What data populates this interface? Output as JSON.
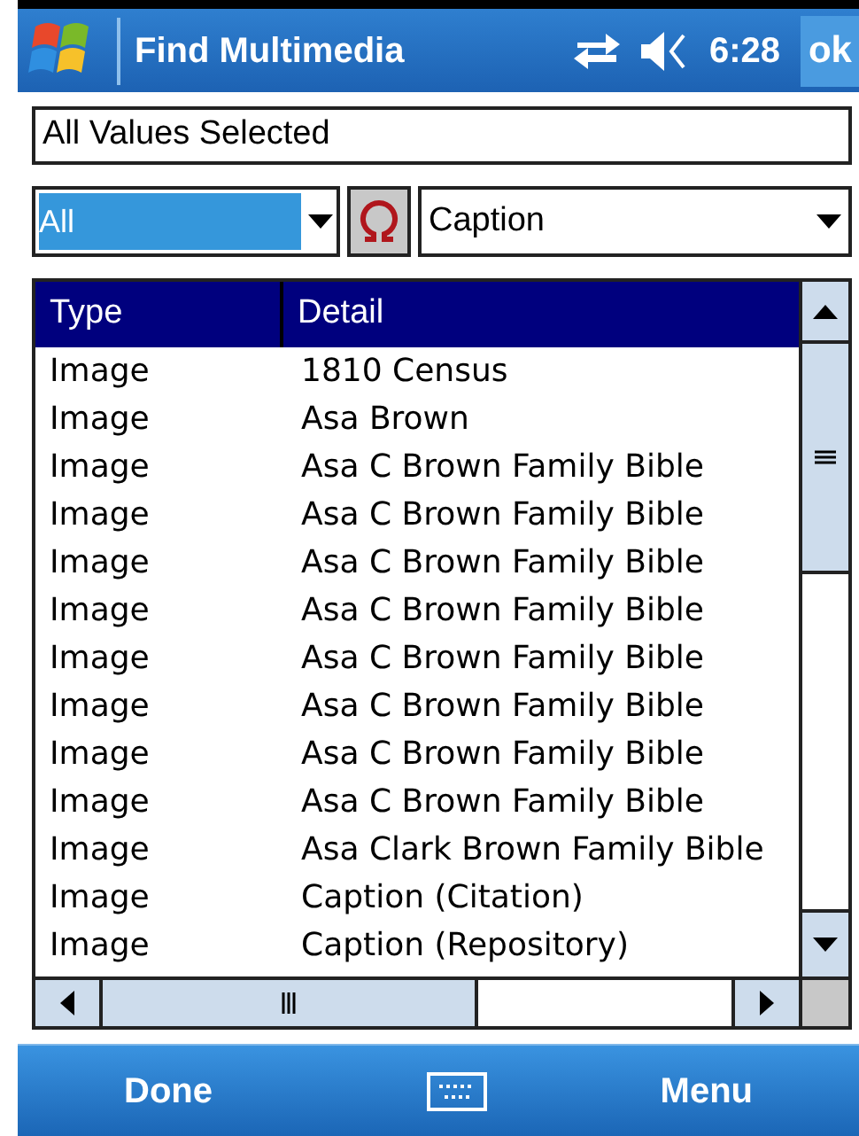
{
  "title_bar": {
    "title": "Find Multimedia",
    "time": "6:28",
    "ok": "ok"
  },
  "filter_field": {
    "value": "All Values Selected"
  },
  "type_dropdown": {
    "value": "All"
  },
  "field_dropdown": {
    "value": "Caption"
  },
  "table": {
    "columns": [
      "Type",
      "Detail"
    ],
    "rows": [
      {
        "type": "Image",
        "detail": "1810 Census"
      },
      {
        "type": "Image",
        "detail": "Asa Brown"
      },
      {
        "type": "Image",
        "detail": "Asa C Brown Family Bible"
      },
      {
        "type": "Image",
        "detail": "Asa C Brown Family Bible"
      },
      {
        "type": "Image",
        "detail": "Asa C Brown Family Bible"
      },
      {
        "type": "Image",
        "detail": "Asa C Brown Family Bible"
      },
      {
        "type": "Image",
        "detail": "Asa C Brown Family Bible"
      },
      {
        "type": "Image",
        "detail": "Asa C Brown Family Bible"
      },
      {
        "type": "Image",
        "detail": "Asa C Brown Family Bible"
      },
      {
        "type": "Image",
        "detail": "Asa C Brown Family Bible"
      },
      {
        "type": "Image",
        "detail": "Asa Clark Brown Family Bible"
      },
      {
        "type": "Image",
        "detail": "Caption (Citation)"
      },
      {
        "type": "Image",
        "detail": "Caption (Repository)"
      }
    ]
  },
  "soft_keys": {
    "left": "Done",
    "right": "Menu"
  }
}
